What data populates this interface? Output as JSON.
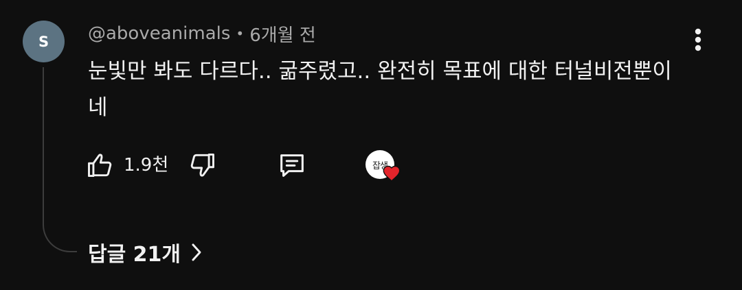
{
  "comment": {
    "avatar_letter": "S",
    "author": "@aboveanimals",
    "separator": "•",
    "time": "6개월 전",
    "text": "눈빛만 봐도 다르다.. 굶주렸고.. 완전히 목표에 대한 터널비전뿐이네",
    "like_count": "1.9천",
    "creator_heart_avatar_text": "잡생",
    "replies_label": "답글 21개"
  },
  "icons": {
    "more": "more-vert-icon",
    "like": "thumb-up-icon",
    "dislike": "thumb-down-icon",
    "reply": "comment-icon",
    "heart": "heart-icon",
    "chevron": "chevron-right-icon"
  },
  "colors": {
    "background": "#0f0f0f",
    "avatar": "#5c7382",
    "heart": "#e3242b",
    "meta_text": "#aaaaaa",
    "text": "#f1f1f1"
  }
}
